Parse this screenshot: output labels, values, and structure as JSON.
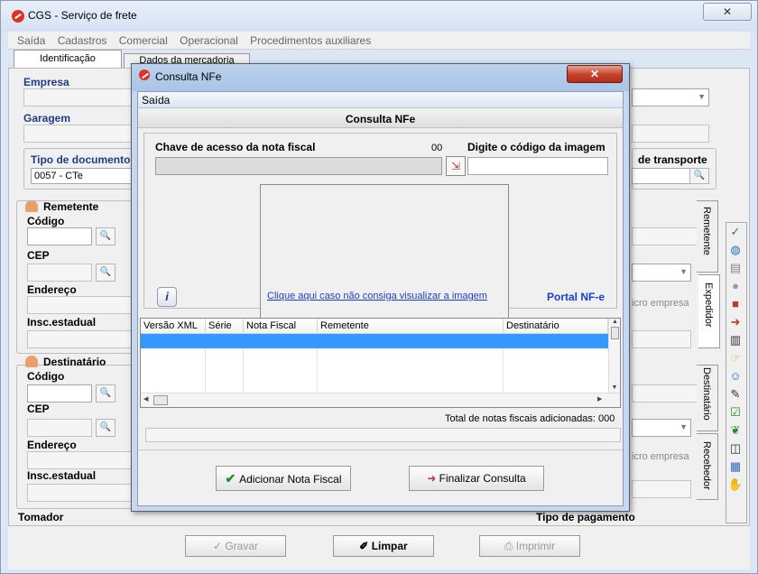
{
  "app": {
    "title": "CGS - Serviço de frete",
    "close_glyph": "✕",
    "menu": [
      "Saída",
      "Cadastros",
      "Comercial",
      "Operacional",
      "Procedimentos auxiliares"
    ]
  },
  "tabs": [
    "Identificação",
    "Dados da mercadoria"
  ],
  "form": {
    "empresa_label": "Empresa",
    "garagem_label": "Garagem",
    "tipo_doc_label": "Tipo de documento",
    "tipo_doc_value": "0057 - CTe",
    "transporte_label": "de transporte",
    "remetente_title": "Remetente",
    "destinatario_title": "Destinatário",
    "codigo_label": "Código",
    "cep_label": "CEP",
    "endereco_label": "Endereço",
    "insc_label": "Insc.estadual",
    "micro_empresa": "icro empresa",
    "tomador_label": "Tomador",
    "tipo_pagamento_label": "Tipo de pagamento"
  },
  "side_tabs": [
    "Remetente",
    "Expedidor",
    "Destinatário",
    "Recebedor"
  ],
  "right_toolbar": [
    "check-icon",
    "globe-icon",
    "cert-icon",
    "circle-icon",
    "box-icon",
    "arrow-right-icon",
    "pages-icon",
    "hand-icon",
    "people-icon",
    "edit-icon",
    "doc-check-icon",
    "leaf-icon",
    "book-icon",
    "scan-icon",
    "handshake-icon"
  ],
  "bottom": {
    "gravar": "Gravar",
    "limpar": "Limpar",
    "imprimir": "Imprimir"
  },
  "dialog": {
    "title": "Consulta NFe",
    "close_glyph": "✕",
    "menu": "Saída",
    "header": "Consulta NFe",
    "chave_label": "Chave de acesso da nota fiscal",
    "chave_count": "00",
    "captcha_label": "Digite o código da imagem",
    "info_glyph": "i",
    "captcha_link": "Clique aqui caso não consiga visualizar a imagem",
    "portal_link": "Portal NF-e",
    "columns": [
      "Versão XML",
      "Série",
      "Nota Fiscal",
      "Remetente",
      "Destinatário"
    ],
    "total_label": "Total de notas fiscais adicionadas: 000",
    "add_button": "Adicionar Nota Fiscal",
    "finish_button": "Finalizar Consulta"
  },
  "colors": {
    "accent": "#1f3c8a",
    "selection": "#3399ff",
    "link": "#1a3fcf"
  }
}
